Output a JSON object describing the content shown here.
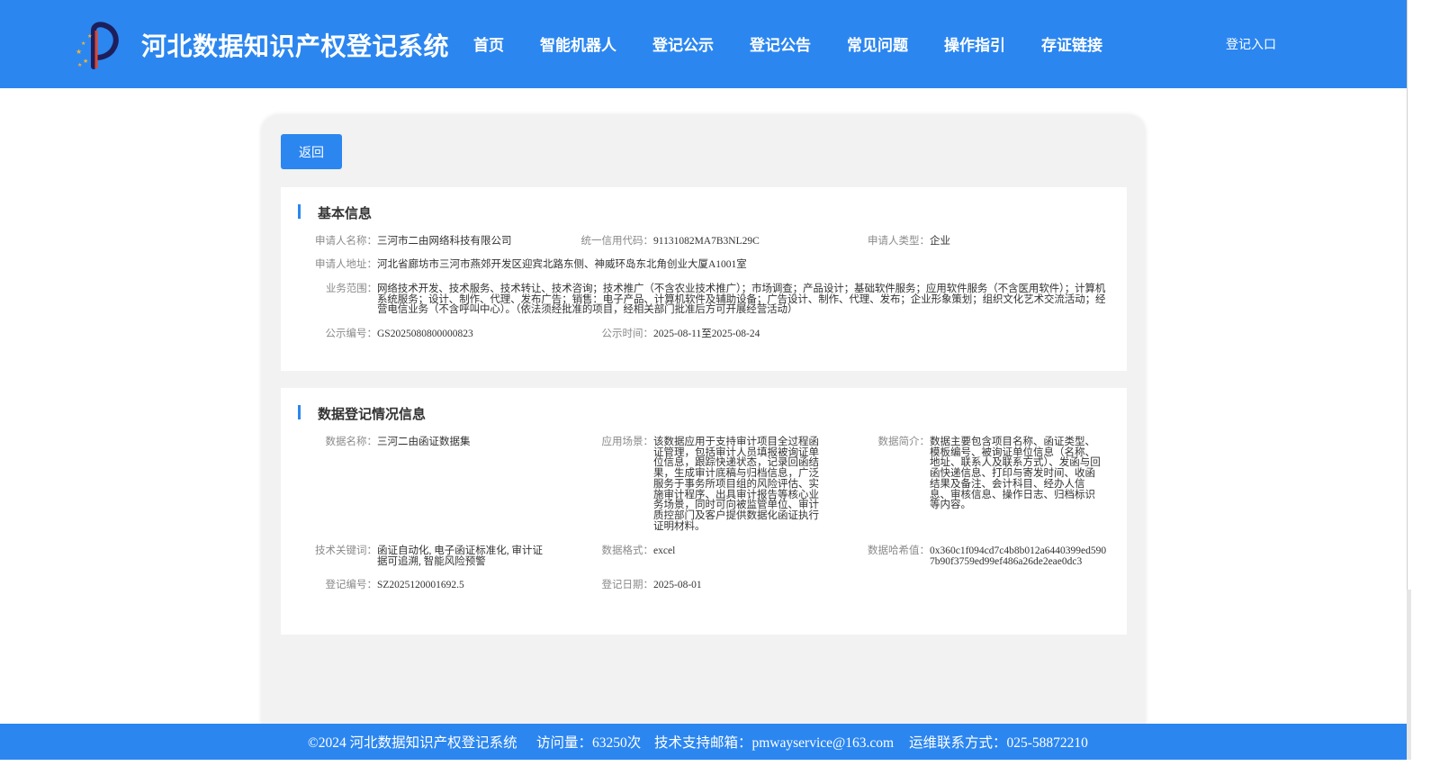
{
  "header": {
    "title": "河北数据知识产权登记系统",
    "nav": [
      "首页",
      "智能机器人",
      "登记公示",
      "登记公告",
      "常见问题",
      "操作指引",
      "存证链接"
    ],
    "login": "登记入口"
  },
  "back_label": "返回",
  "basic": {
    "title": "基本信息",
    "applicant_name": {
      "label": "申请人名称：",
      "value": "三河市二由网络科技有限公司"
    },
    "credit_code": {
      "label": "统一信用代码：",
      "value": "91131082MA7B3NL29C"
    },
    "applicant_type": {
      "label": "申请人类型：",
      "value": "企业"
    },
    "address": {
      "label": "申请人地址：",
      "value": "河北省廊坊市三河市燕郊开发区迎宾北路东侧、神威环岛东北角创业大厦A1001室"
    },
    "business_scope": {
      "label": "业务范围：",
      "value": "网络技术开发、技术服务、技术转让、技术咨询；技术推广（不含农业技术推广）；市场调查；产品设计；基础软件服务；应用软件服务（不含医用软件）；计算机系统服务；设计、制作、代理、发布广告；销售：电子产品、计算机软件及辅助设备；广告设计、制作、代理、发布；企业形象策划；组织文化艺术交流活动；经营电信业务（不含呼叫中心）。（依法须经批准的项目，经相关部门批准后方可开展经营活动）"
    },
    "publicity_no": {
      "label": "公示编号：",
      "value": "GS2025080800000823"
    },
    "publicity_time": {
      "label": "公示时间：",
      "value": "2025-08-11至2025-08-24"
    }
  },
  "registration": {
    "title": "数据登记情况信息",
    "data_name": {
      "label": "数据名称：",
      "value": "三河二由函证数据集"
    },
    "scenario": {
      "label": "应用场景：",
      "value": "该数据应用于支持审计项目全过程函证管理，包括审计人员填报被询证单位信息，跟踪快递状态，记录回函结果，生成审计底稿与归档信息，广泛服务于事务所项目组的风险评估、实施审计程序、出具审计报告等核心业务场景，同时可向被监管单位、审计质控部门及客户提供数据化函证执行证明材料。"
    },
    "summary": {
      "label": "数据简介：",
      "value": "数据主要包含项目名称、函证类型、模板编号、被询证单位信息（名称、地址、联系人及联系方式）、发函与回函快递信息、打印与寄发时间、收函结果及备注、会计科目、经办人信息、审核信息、操作日志、归档标识等内容。"
    },
    "keywords": {
      "label": "技术关键词：",
      "value": "函证自动化, 电子函证标准化, 审计证据可追溯, 智能风险预警"
    },
    "format": {
      "label": "数据格式：",
      "value": "excel"
    },
    "hash": {
      "label": "数据哈希值：",
      "value": "0x360c1f094cd7c4b8b012a6440399ed5907b90f3759ed99ef486a26de2eae0dc3"
    },
    "reg_no": {
      "label": "登记编号：",
      "value": "SZ2025120001692.5"
    },
    "reg_date": {
      "label": "登记日期：",
      "value": "2025-08-01"
    }
  },
  "footer": {
    "copyright": "©2024 河北数据知识产权登记系统",
    "visits": "访问量：63250次",
    "email": "技术支持邮箱：pmwayservice@163.com",
    "phone": "运维联系方式：025-58872210"
  },
  "colors": {
    "primary": "#2b86f0",
    "card_bg": "#f2f2f2",
    "label": "#8a8a8a",
    "text": "#333333"
  }
}
